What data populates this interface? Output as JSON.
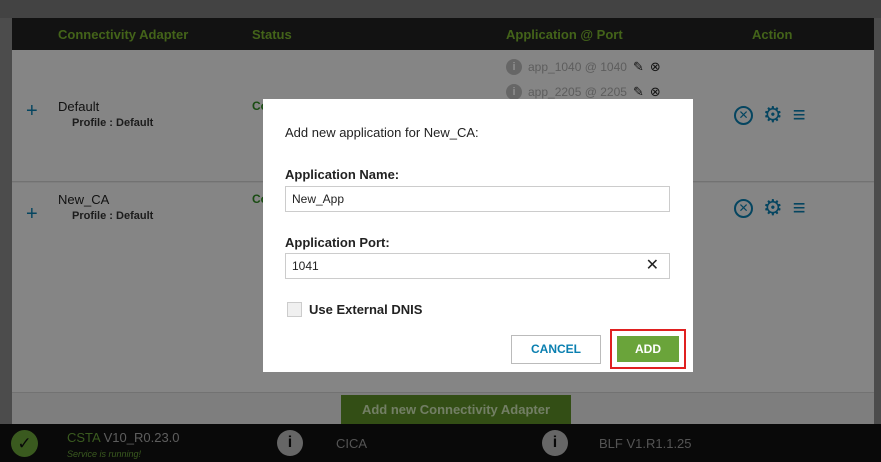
{
  "table": {
    "headers": {
      "adapter": "Connectivity Adapter",
      "status": "Status",
      "app_port": "Application @ Port",
      "action": "Action"
    },
    "rows": [
      {
        "name": "Default",
        "profile": "Profile : Default",
        "status_partial": "Co",
        "apps": [
          {
            "label": "app_1040 @ 1040"
          },
          {
            "label": "app_2205 @ 2205"
          }
        ]
      },
      {
        "name": "New_CA",
        "profile": "Profile : Default",
        "status_partial": "Co",
        "apps": []
      }
    ]
  },
  "add_adapter_button": "Add new Connectivity Adapter",
  "footer": {
    "csta_brand": "CSTA",
    "csta_version": "V10_R0.23.0",
    "csta_status": "Service is running!",
    "cica_label": "CICA",
    "blf_brand": "BLF",
    "blf_version": "V1.R1.1.25"
  },
  "dialog": {
    "title": "Add new application for New_CA:",
    "app_name_label": "Application Name:",
    "app_name_value": "New_App",
    "app_port_label": "Application Port:",
    "app_port_value": "1041",
    "dnis_label": "Use External DNIS",
    "cancel_label": "CANCEL",
    "add_label": "ADD"
  },
  "icons": {
    "plus": "plus-icon",
    "info": "info-icon",
    "pencil": "pencil-icon",
    "remove": "remove-circle-icon",
    "gear": "gear-icon",
    "menu": "hamburger-menu-icon",
    "check": "check-circle-icon",
    "clear": "clear-x-icon"
  },
  "colors": {
    "accent_green": "#6aa43a",
    "accent_blue": "#0a7fb0",
    "highlight_red": "#e02020"
  }
}
